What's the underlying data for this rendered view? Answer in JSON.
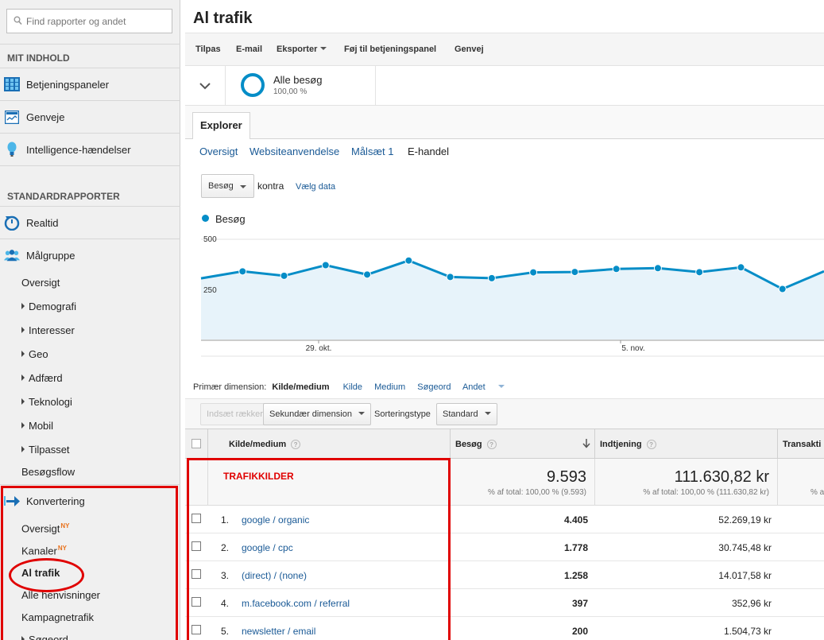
{
  "search": {
    "placeholder": "Find rapporter og andet"
  },
  "sidebar": {
    "section_my": "MIT INDHOLD",
    "my_items": [
      "Betjeningspaneler",
      "Genveje",
      "Intelligence-hændelser"
    ],
    "section_standard": "STANDARDRAPPORTER",
    "realtime": "Realtid",
    "audience": "Målgruppe",
    "audience_items": [
      "Oversigt",
      "Demografi",
      "Interesser",
      "Geo",
      "Adfærd",
      "Teknologi",
      "Mobil",
      "Tilpasset",
      "Besøgsflow"
    ],
    "conversion": "Konvertering",
    "conversion_items": [
      "Oversigt",
      "Kanaler",
      "Al trafik",
      "Alle henvisninger",
      "Kampagnetrafik",
      "Søgeord"
    ],
    "new_badge": "NY"
  },
  "page": {
    "title": "Al trafik"
  },
  "toolbar": {
    "items": [
      "Tilpas",
      "E-mail",
      "Eksporter",
      "Føj til betjeningspanel",
      "Genvej"
    ]
  },
  "segment": {
    "name": "Alle besøg",
    "percent": "100,00 %"
  },
  "explorer": {
    "tab": "Explorer",
    "subtabs": [
      "Oversigt",
      "Websiteanvendelse",
      "Målsæt 1",
      "E-handel"
    ],
    "metric": "Besøg",
    "versus": "kontra",
    "choose": "Vælg data",
    "legend": "Besøg"
  },
  "chart_data": {
    "type": "area",
    "series": [
      {
        "name": "Besøg",
        "values": [
          305,
          340,
          318,
          371,
          324,
          394,
          312,
          306,
          335,
          337,
          352,
          356,
          336,
          360,
          252,
          340
        ]
      }
    ],
    "ylim": [
      0,
      500
    ],
    "yticks": [
      "500",
      "250"
    ],
    "xtick_labels": [
      "29. okt.",
      "5. nov."
    ],
    "grid": true,
    "color": "#058dc7"
  },
  "dimension": {
    "label": "Primær dimension:",
    "active": "Kilde/medium",
    "links": [
      "Kilde",
      "Medium",
      "Søgeord",
      "Andet"
    ]
  },
  "controls": {
    "insert_rows": "Indsæt rækker",
    "secondary": "Sekundær dimension",
    "sort_label": "Sorteringstype",
    "sort_value": "Standard"
  },
  "table": {
    "headers": {
      "source": "Kilde/medium",
      "visits": "Besøg",
      "revenue": "Indtjening",
      "transactions": "Transakti"
    },
    "annotation": "TRAFIKKILDER",
    "totals": {
      "visits": "9.593",
      "visits_pct": "% af total: 100,00 % (9.593)",
      "revenue": "111.630,82 kr",
      "revenue_pct": "% af total: 100,00 % (111.630,82 kr)",
      "transactions_pct": "% af"
    },
    "rows": [
      {
        "num": "1.",
        "source": "google / organic",
        "visits": "4.405",
        "revenue": "52.269,19 kr"
      },
      {
        "num": "2.",
        "source": "google / cpc",
        "visits": "1.778",
        "revenue": "30.745,48 kr"
      },
      {
        "num": "3.",
        "source": "(direct) / (none)",
        "visits": "1.258",
        "revenue": "14.017,58 kr"
      },
      {
        "num": "4.",
        "source": "m.facebook.com / referral",
        "visits": "397",
        "revenue": "352,96 kr"
      },
      {
        "num": "5.",
        "source": "newsletter / email",
        "visits": "200",
        "revenue": "1.504,73 kr"
      }
    ]
  }
}
